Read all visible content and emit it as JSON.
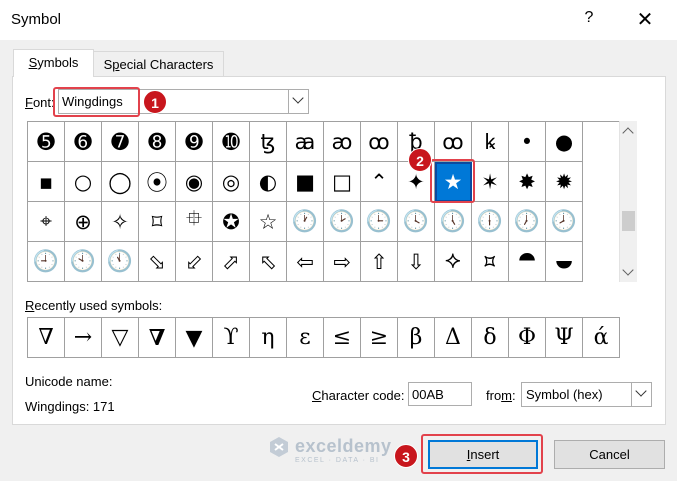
{
  "window": {
    "title": "Symbol",
    "help_label": "?",
    "close_label": "✕"
  },
  "tabs": [
    {
      "label_pre": "",
      "label_key": "S",
      "label_post": "ymbols",
      "active": true
    },
    {
      "label_pre": "S",
      "label_key": "p",
      "label_post": "ecial Characters",
      "active": false
    }
  ],
  "font": {
    "label_key": "F",
    "label_post": "ont:",
    "value": "Wingdings"
  },
  "symbol_grid": {
    "rows": [
      [
        "➎",
        "➏",
        "➐",
        "➑",
        "➒",
        "➓",
        "ꜩ",
        "ꜳ",
        "ꜵ",
        "ꝏ",
        "ꝥ",
        "ꝏ",
        "ꝃ",
        "•",
        "●"
      ],
      [
        "▪",
        "○",
        "◯",
        "⦿",
        "◉",
        "◎",
        "◐",
        "■",
        "□",
        "⌃",
        "✦",
        "★",
        "✶",
        "✸",
        "✹"
      ],
      [
        "⌖",
        "⊕",
        "✧",
        "⌑",
        "⯐",
        "✪",
        "☆",
        "🕐",
        "🕑",
        "🕒",
        "🕓",
        "🕔",
        "🕕",
        "🕖",
        "🕗"
      ],
      [
        "🕘",
        "🕙",
        "🕚",
        "⬂",
        "⬃",
        "⬀",
        "⬁",
        "⇦",
        "⇨",
        "⇧",
        "⇩",
        "⯎",
        "⯏",
        "⯊",
        "⯋"
      ]
    ],
    "selected_row": 1,
    "selected_col": 11
  },
  "recent": {
    "label_key": "R",
    "label_post": "ecently used symbols:",
    "symbols": [
      "∇",
      "→",
      "▽",
      "∇",
      "▼",
      "ϒ",
      "η",
      "ε",
      "≤",
      "≥",
      "β",
      "Δ",
      "δ",
      "Φ",
      "Ψ",
      "ά"
    ]
  },
  "unicode": {
    "name_label": "Unicode name:",
    "name_value": "Wingdings: 171"
  },
  "character_code": {
    "label_key": "C",
    "label_pre": "",
    "label_post": "haracter code:",
    "value": "00AB"
  },
  "from": {
    "label_pre": "fro",
    "label_key": "m",
    "label_post": ":",
    "value": "Symbol (hex)"
  },
  "buttons": {
    "insert_label_key": "I",
    "insert_label_post": "nsert",
    "cancel_label": "Cancel"
  },
  "annotations": {
    "badge1": "1",
    "badge2": "2",
    "badge3": "3",
    "accent_color": "#e2424c",
    "badge_color": "#c8161d"
  },
  "watermark": {
    "name": "exceldemy",
    "tagline": "EXCEL · DATA · BI"
  }
}
